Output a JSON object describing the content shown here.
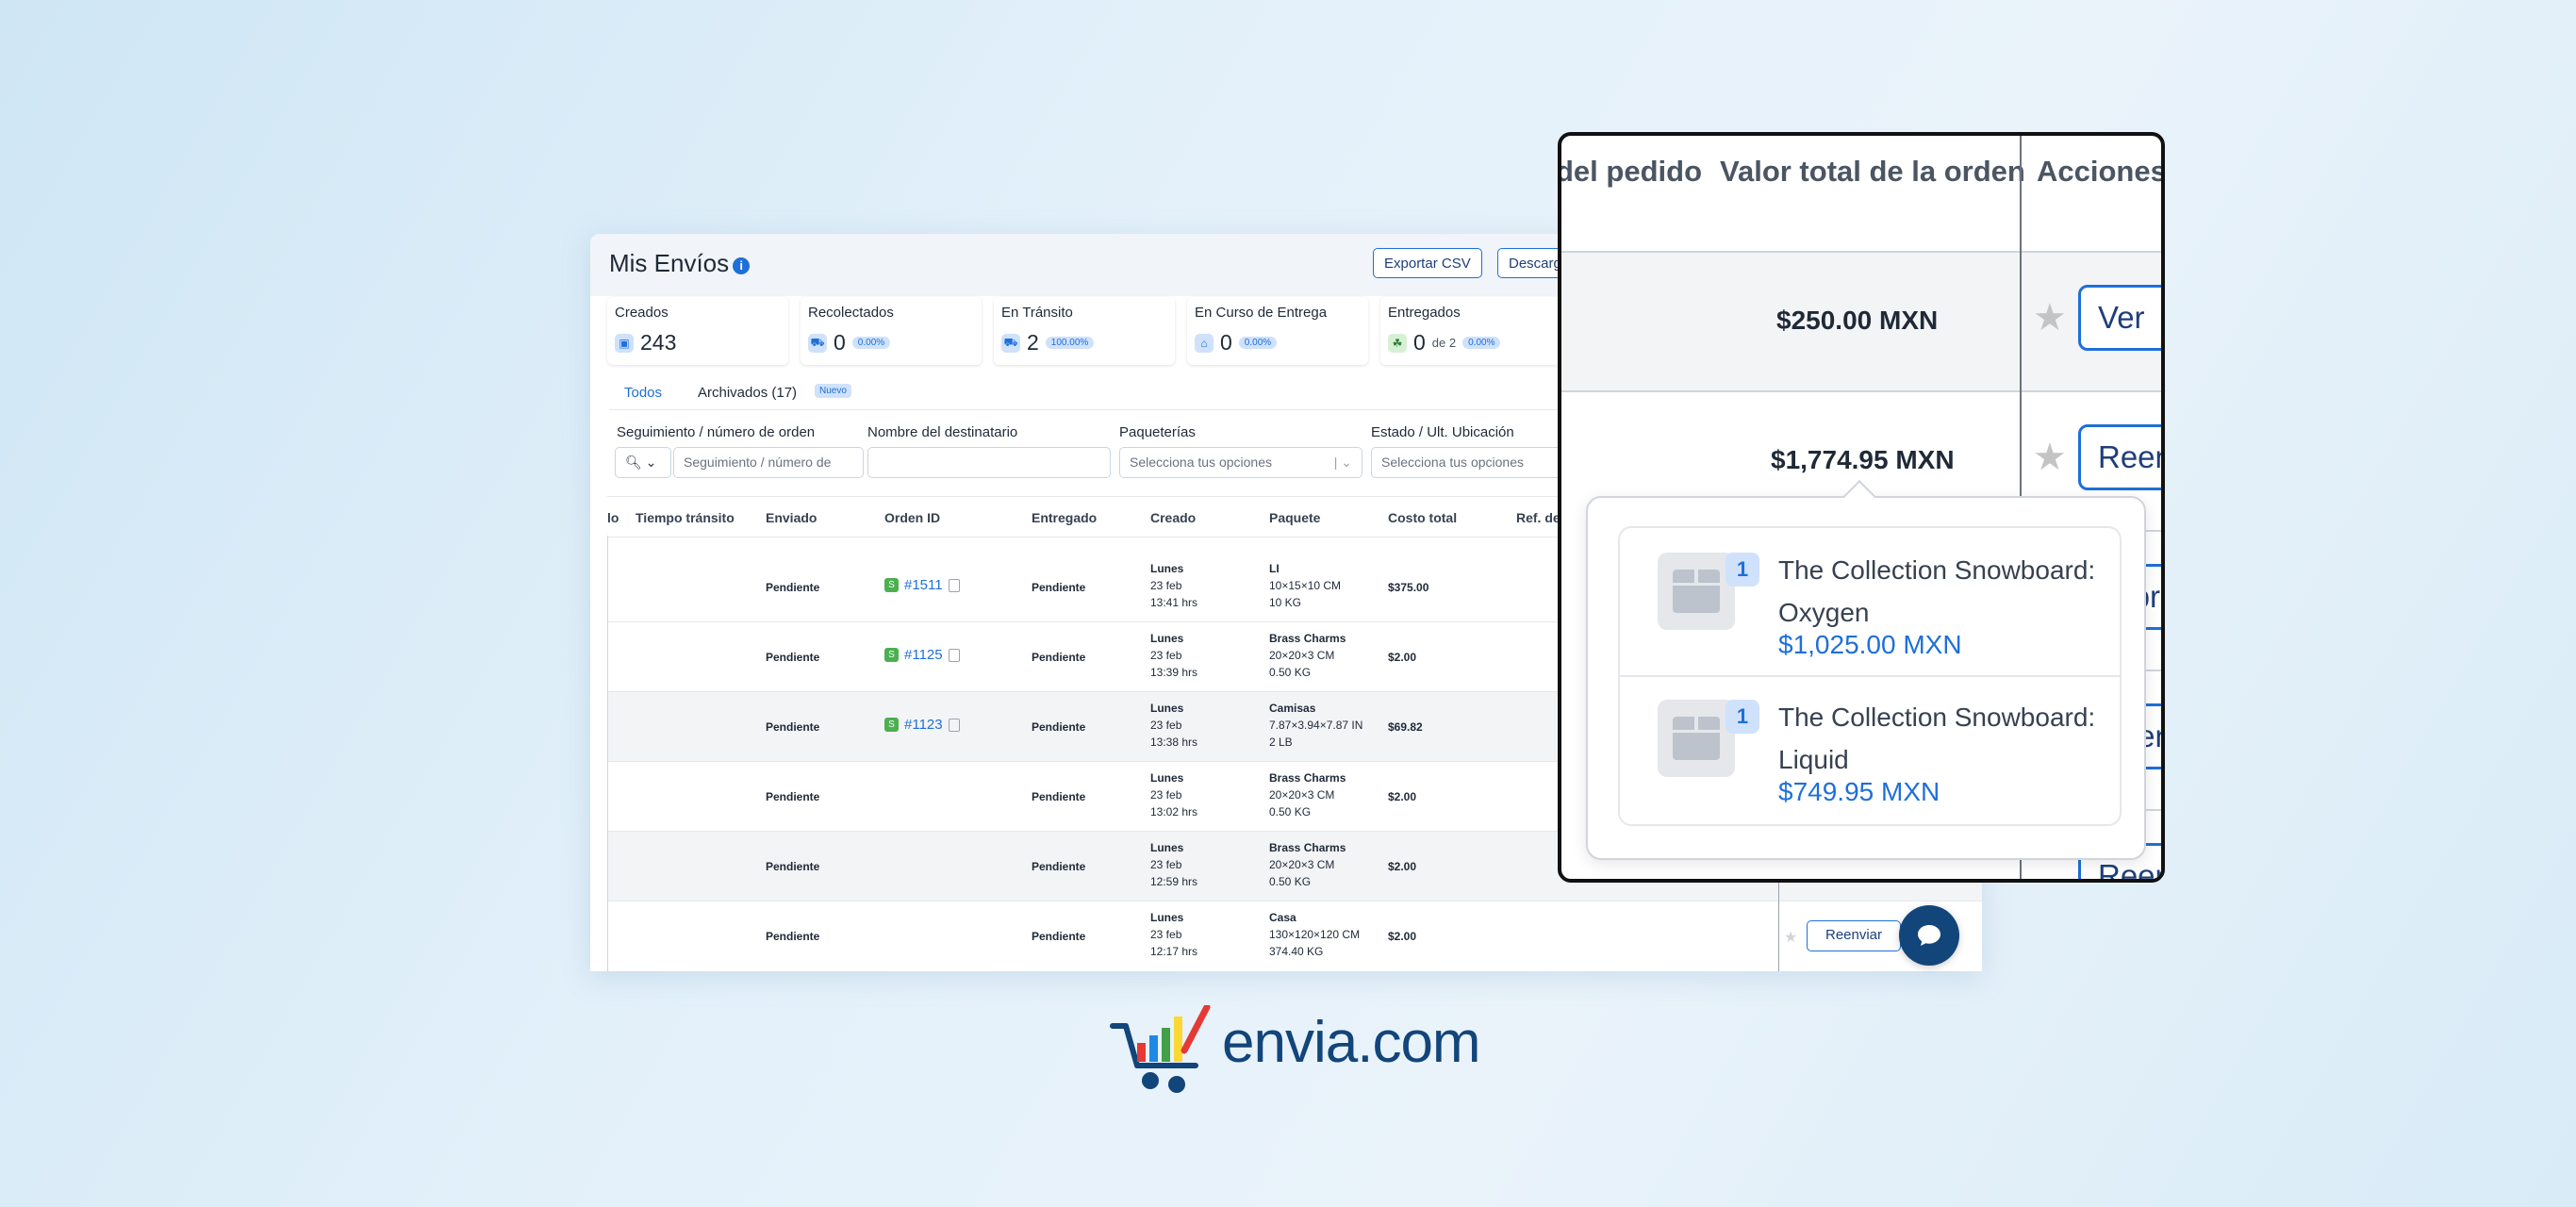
{
  "header": {
    "title": "Mis Envíos",
    "export_label": "Exportar CSV",
    "download_label": "Descargar"
  },
  "stats": [
    {
      "label": "Creados",
      "value": "243",
      "pct": "",
      "extra": ""
    },
    {
      "label": "Recolectados",
      "value": "0",
      "pct": "0.00%",
      "extra": ""
    },
    {
      "label": "En Tránsito",
      "value": "2",
      "pct": "100.00%",
      "extra": ""
    },
    {
      "label": "En Curso de Entrega",
      "value": "0",
      "pct": "0.00%",
      "extra": ""
    },
    {
      "label": "Entregados",
      "value": "0",
      "pct": "0.00%",
      "extra": "de 2"
    }
  ],
  "tabs": {
    "all": "Todos",
    "archived": "Archivados (17)",
    "new_badge": "Nuevo"
  },
  "filters": {
    "tracking_label": "Seguimiento / número de orden",
    "tracking_placeholder": "Seguimiento / número de",
    "recipient_label": "Nombre del destinatario",
    "carriers_label": "Paqueterías",
    "carriers_placeholder": "Selecciona tus opciones",
    "status_label": "Estado / Ult. Ubicación",
    "status_placeholder": "Selecciona tus opciones"
  },
  "table": {
    "columns": [
      "lo",
      "Tiempo tránsito",
      "Enviado",
      "Orden ID",
      "Entregado",
      "Creado",
      "Paquete",
      "Costo total",
      "Ref. de"
    ],
    "rows": [
      {
        "sent": "Pendiente",
        "order": "#1511",
        "delivered": "Pendiente",
        "created": [
          "Lunes",
          "23 feb",
          "13:41 hrs"
        ],
        "package": [
          "LI",
          "10×15×10 CM",
          "10 KG"
        ],
        "cost": "$375.00"
      },
      {
        "sent": "Pendiente",
        "order": "#1125",
        "delivered": "Pendiente",
        "created": [
          "Lunes",
          "23 feb",
          "13:39 hrs"
        ],
        "package": [
          "Brass Charms",
          "20×20×3 CM",
          "0.50 KG"
        ],
        "cost": "$2.00"
      },
      {
        "sent": "Pendiente",
        "order": "#1123",
        "delivered": "Pendiente",
        "created": [
          "Lunes",
          "23 feb",
          "13:38 hrs"
        ],
        "package": [
          "Camisas",
          "7.87×3.94×7.87 IN",
          "2 LB"
        ],
        "cost": "$69.82"
      },
      {
        "sent": "Pendiente",
        "order": "",
        "delivered": "Pendiente",
        "created": [
          "Lunes",
          "23 feb",
          "13:02 hrs"
        ],
        "package": [
          "Brass Charms",
          "20×20×3 CM",
          "0.50 KG"
        ],
        "cost": "$2.00"
      },
      {
        "sent": "Pendiente",
        "order": "",
        "delivered": "Pendiente",
        "created": [
          "Lunes",
          "23 feb",
          "12:59 hrs"
        ],
        "package": [
          "Brass Charms",
          "20×20×3 CM",
          "0.50 KG"
        ],
        "cost": "$2.00"
      },
      {
        "sent": "Pendiente",
        "order": "",
        "delivered": "Pendiente",
        "created": [
          "Lunes",
          "23 feb",
          "12:17 hrs"
        ],
        "package": [
          "Casa",
          "130×120×120 CM",
          "374.40 KG"
        ],
        "cost": "$2.00"
      }
    ],
    "resend_label": "Reenviar"
  },
  "zoom": {
    "col_order": "del pedido",
    "col_total": "Valor total de la orden",
    "col_actions": "Acciones",
    "row1_total": "$250.00 MXN",
    "row1_button": "Ver",
    "row2_total": "$1,774.95 MXN",
    "row2_button": "Reenviar",
    "row3_button": "Imprimir",
    "row4_button": "Reenviar",
    "row5_button": "Reenviar",
    "popover_items": [
      {
        "qty": "1",
        "name": "The Collection Snowboard: Oxygen",
        "price": "$1,025.00 MXN"
      },
      {
        "qty": "1",
        "name": "The Collection Snowboard: Liquid",
        "price": "$749.95 MXN"
      }
    ]
  },
  "brand": {
    "name": "envia.com"
  },
  "colors": {
    "accent": "#1e6fd9",
    "brand_navy": "#12457a"
  }
}
